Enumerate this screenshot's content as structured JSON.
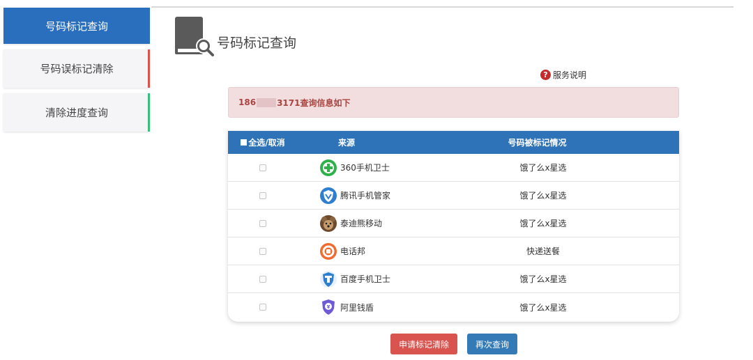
{
  "sidebar": {
    "items": [
      {
        "label": "号码标记查询"
      },
      {
        "label": "号码误标记清除"
      },
      {
        "label": "清除进度查询"
      }
    ]
  },
  "header": {
    "title": "号码标记查询"
  },
  "service_link": "服务说明",
  "alert": {
    "prefix": "186",
    "suffix": "3171查询信息如下"
  },
  "table": {
    "headers": {
      "select_all": "全选/取消",
      "source": "来源",
      "status": "号码被标记情况"
    },
    "rows": [
      {
        "source": "360手机卫士",
        "status": "饿了么x星选",
        "icon": "shield-plus-icon"
      },
      {
        "source": "腾讯手机管家",
        "status": "饿了么x星选",
        "icon": "tencent-shield-icon"
      },
      {
        "source": "泰迪熊移动",
        "status": "饿了么x星选",
        "icon": "teddy-bear-icon"
      },
      {
        "source": "电话邦",
        "status": "快递送餐",
        "icon": "phone-bang-icon"
      },
      {
        "source": "百度手机卫士",
        "status": "饿了么x星选",
        "icon": "baidu-shield-icon"
      },
      {
        "source": "阿里钱盾",
        "status": "饿了么x星选",
        "icon": "ali-shield-icon"
      }
    ]
  },
  "buttons": {
    "clear": "申请标记清除",
    "requery": "再次查询"
  },
  "colors": {
    "primary": "#2e72b8",
    "danger": "#d9534f",
    "alert_bg": "#f2dede",
    "alert_text": "#a94442"
  }
}
